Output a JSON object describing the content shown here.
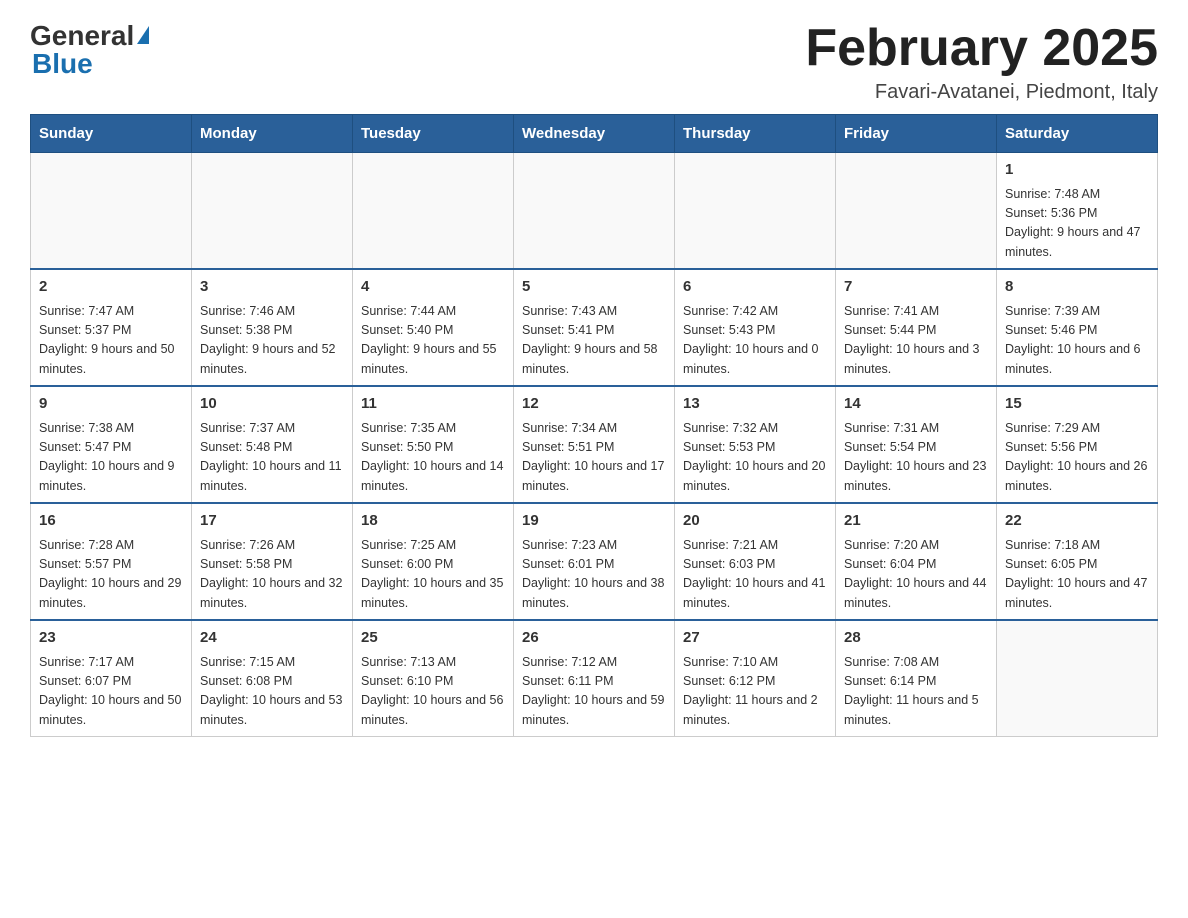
{
  "logo": {
    "general": "General",
    "triangle": "",
    "blue": "Blue"
  },
  "title": {
    "month_year": "February 2025",
    "location": "Favari-Avatanei, Piedmont, Italy"
  },
  "days_of_week": [
    "Sunday",
    "Monday",
    "Tuesday",
    "Wednesday",
    "Thursday",
    "Friday",
    "Saturday"
  ],
  "weeks": [
    [
      {
        "day": "",
        "sunrise": "",
        "sunset": "",
        "daylight": ""
      },
      {
        "day": "",
        "sunrise": "",
        "sunset": "",
        "daylight": ""
      },
      {
        "day": "",
        "sunrise": "",
        "sunset": "",
        "daylight": ""
      },
      {
        "day": "",
        "sunrise": "",
        "sunset": "",
        "daylight": ""
      },
      {
        "day": "",
        "sunrise": "",
        "sunset": "",
        "daylight": ""
      },
      {
        "day": "",
        "sunrise": "",
        "sunset": "",
        "daylight": ""
      },
      {
        "day": "1",
        "sunrise": "Sunrise: 7:48 AM",
        "sunset": "Sunset: 5:36 PM",
        "daylight": "Daylight: 9 hours and 47 minutes."
      }
    ],
    [
      {
        "day": "2",
        "sunrise": "Sunrise: 7:47 AM",
        "sunset": "Sunset: 5:37 PM",
        "daylight": "Daylight: 9 hours and 50 minutes."
      },
      {
        "day": "3",
        "sunrise": "Sunrise: 7:46 AM",
        "sunset": "Sunset: 5:38 PM",
        "daylight": "Daylight: 9 hours and 52 minutes."
      },
      {
        "day": "4",
        "sunrise": "Sunrise: 7:44 AM",
        "sunset": "Sunset: 5:40 PM",
        "daylight": "Daylight: 9 hours and 55 minutes."
      },
      {
        "day": "5",
        "sunrise": "Sunrise: 7:43 AM",
        "sunset": "Sunset: 5:41 PM",
        "daylight": "Daylight: 9 hours and 58 minutes."
      },
      {
        "day": "6",
        "sunrise": "Sunrise: 7:42 AM",
        "sunset": "Sunset: 5:43 PM",
        "daylight": "Daylight: 10 hours and 0 minutes."
      },
      {
        "day": "7",
        "sunrise": "Sunrise: 7:41 AM",
        "sunset": "Sunset: 5:44 PM",
        "daylight": "Daylight: 10 hours and 3 minutes."
      },
      {
        "day": "8",
        "sunrise": "Sunrise: 7:39 AM",
        "sunset": "Sunset: 5:46 PM",
        "daylight": "Daylight: 10 hours and 6 minutes."
      }
    ],
    [
      {
        "day": "9",
        "sunrise": "Sunrise: 7:38 AM",
        "sunset": "Sunset: 5:47 PM",
        "daylight": "Daylight: 10 hours and 9 minutes."
      },
      {
        "day": "10",
        "sunrise": "Sunrise: 7:37 AM",
        "sunset": "Sunset: 5:48 PM",
        "daylight": "Daylight: 10 hours and 11 minutes."
      },
      {
        "day": "11",
        "sunrise": "Sunrise: 7:35 AM",
        "sunset": "Sunset: 5:50 PM",
        "daylight": "Daylight: 10 hours and 14 minutes."
      },
      {
        "day": "12",
        "sunrise": "Sunrise: 7:34 AM",
        "sunset": "Sunset: 5:51 PM",
        "daylight": "Daylight: 10 hours and 17 minutes."
      },
      {
        "day": "13",
        "sunrise": "Sunrise: 7:32 AM",
        "sunset": "Sunset: 5:53 PM",
        "daylight": "Daylight: 10 hours and 20 minutes."
      },
      {
        "day": "14",
        "sunrise": "Sunrise: 7:31 AM",
        "sunset": "Sunset: 5:54 PM",
        "daylight": "Daylight: 10 hours and 23 minutes."
      },
      {
        "day": "15",
        "sunrise": "Sunrise: 7:29 AM",
        "sunset": "Sunset: 5:56 PM",
        "daylight": "Daylight: 10 hours and 26 minutes."
      }
    ],
    [
      {
        "day": "16",
        "sunrise": "Sunrise: 7:28 AM",
        "sunset": "Sunset: 5:57 PM",
        "daylight": "Daylight: 10 hours and 29 minutes."
      },
      {
        "day": "17",
        "sunrise": "Sunrise: 7:26 AM",
        "sunset": "Sunset: 5:58 PM",
        "daylight": "Daylight: 10 hours and 32 minutes."
      },
      {
        "day": "18",
        "sunrise": "Sunrise: 7:25 AM",
        "sunset": "Sunset: 6:00 PM",
        "daylight": "Daylight: 10 hours and 35 minutes."
      },
      {
        "day": "19",
        "sunrise": "Sunrise: 7:23 AM",
        "sunset": "Sunset: 6:01 PM",
        "daylight": "Daylight: 10 hours and 38 minutes."
      },
      {
        "day": "20",
        "sunrise": "Sunrise: 7:21 AM",
        "sunset": "Sunset: 6:03 PM",
        "daylight": "Daylight: 10 hours and 41 minutes."
      },
      {
        "day": "21",
        "sunrise": "Sunrise: 7:20 AM",
        "sunset": "Sunset: 6:04 PM",
        "daylight": "Daylight: 10 hours and 44 minutes."
      },
      {
        "day": "22",
        "sunrise": "Sunrise: 7:18 AM",
        "sunset": "Sunset: 6:05 PM",
        "daylight": "Daylight: 10 hours and 47 minutes."
      }
    ],
    [
      {
        "day": "23",
        "sunrise": "Sunrise: 7:17 AM",
        "sunset": "Sunset: 6:07 PM",
        "daylight": "Daylight: 10 hours and 50 minutes."
      },
      {
        "day": "24",
        "sunrise": "Sunrise: 7:15 AM",
        "sunset": "Sunset: 6:08 PM",
        "daylight": "Daylight: 10 hours and 53 minutes."
      },
      {
        "day": "25",
        "sunrise": "Sunrise: 7:13 AM",
        "sunset": "Sunset: 6:10 PM",
        "daylight": "Daylight: 10 hours and 56 minutes."
      },
      {
        "day": "26",
        "sunrise": "Sunrise: 7:12 AM",
        "sunset": "Sunset: 6:11 PM",
        "daylight": "Daylight: 10 hours and 59 minutes."
      },
      {
        "day": "27",
        "sunrise": "Sunrise: 7:10 AM",
        "sunset": "Sunset: 6:12 PM",
        "daylight": "Daylight: 11 hours and 2 minutes."
      },
      {
        "day": "28",
        "sunrise": "Sunrise: 7:08 AM",
        "sunset": "Sunset: 6:14 PM",
        "daylight": "Daylight: 11 hours and 5 minutes."
      },
      {
        "day": "",
        "sunrise": "",
        "sunset": "",
        "daylight": ""
      }
    ]
  ]
}
